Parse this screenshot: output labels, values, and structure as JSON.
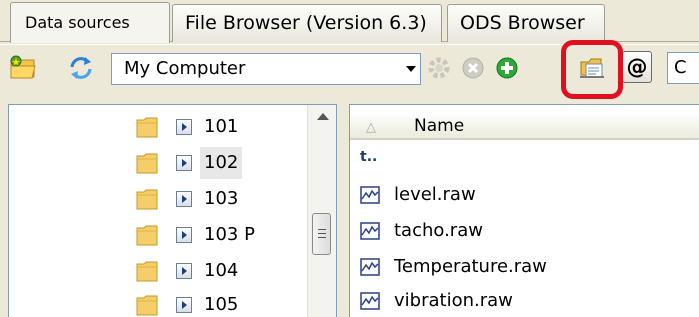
{
  "tabs": [
    {
      "label": "Data sources",
      "active": true
    },
    {
      "label": "File Browser (Version 6.3)",
      "active": false
    },
    {
      "label": "ODS Browser",
      "active": false
    }
  ],
  "toolbar": {
    "left_icons": [
      "folder-favorites-icon",
      "refresh-icon"
    ],
    "location": "My Computer",
    "right_icons": [
      "settings-gear-icon",
      "stop-icon",
      "add-icon",
      "properties-icon",
      "at-sign-icon"
    ],
    "at_label": "@",
    "combo2_value": "C",
    "highlight_color": "#e01020"
  },
  "tree": {
    "items": [
      {
        "label": "101"
      },
      {
        "label": "102",
        "selected": true
      },
      {
        "label": "103"
      },
      {
        "label": "103 P"
      },
      {
        "label": "104"
      },
      {
        "label": "105"
      }
    ]
  },
  "files": {
    "column_name": "Name",
    "up_dir_glyph": "t..",
    "items": [
      {
        "name": "level.raw"
      },
      {
        "name": "tacho.raw"
      },
      {
        "name": "Temperature.raw"
      },
      {
        "name": "vibration.raw"
      }
    ]
  }
}
